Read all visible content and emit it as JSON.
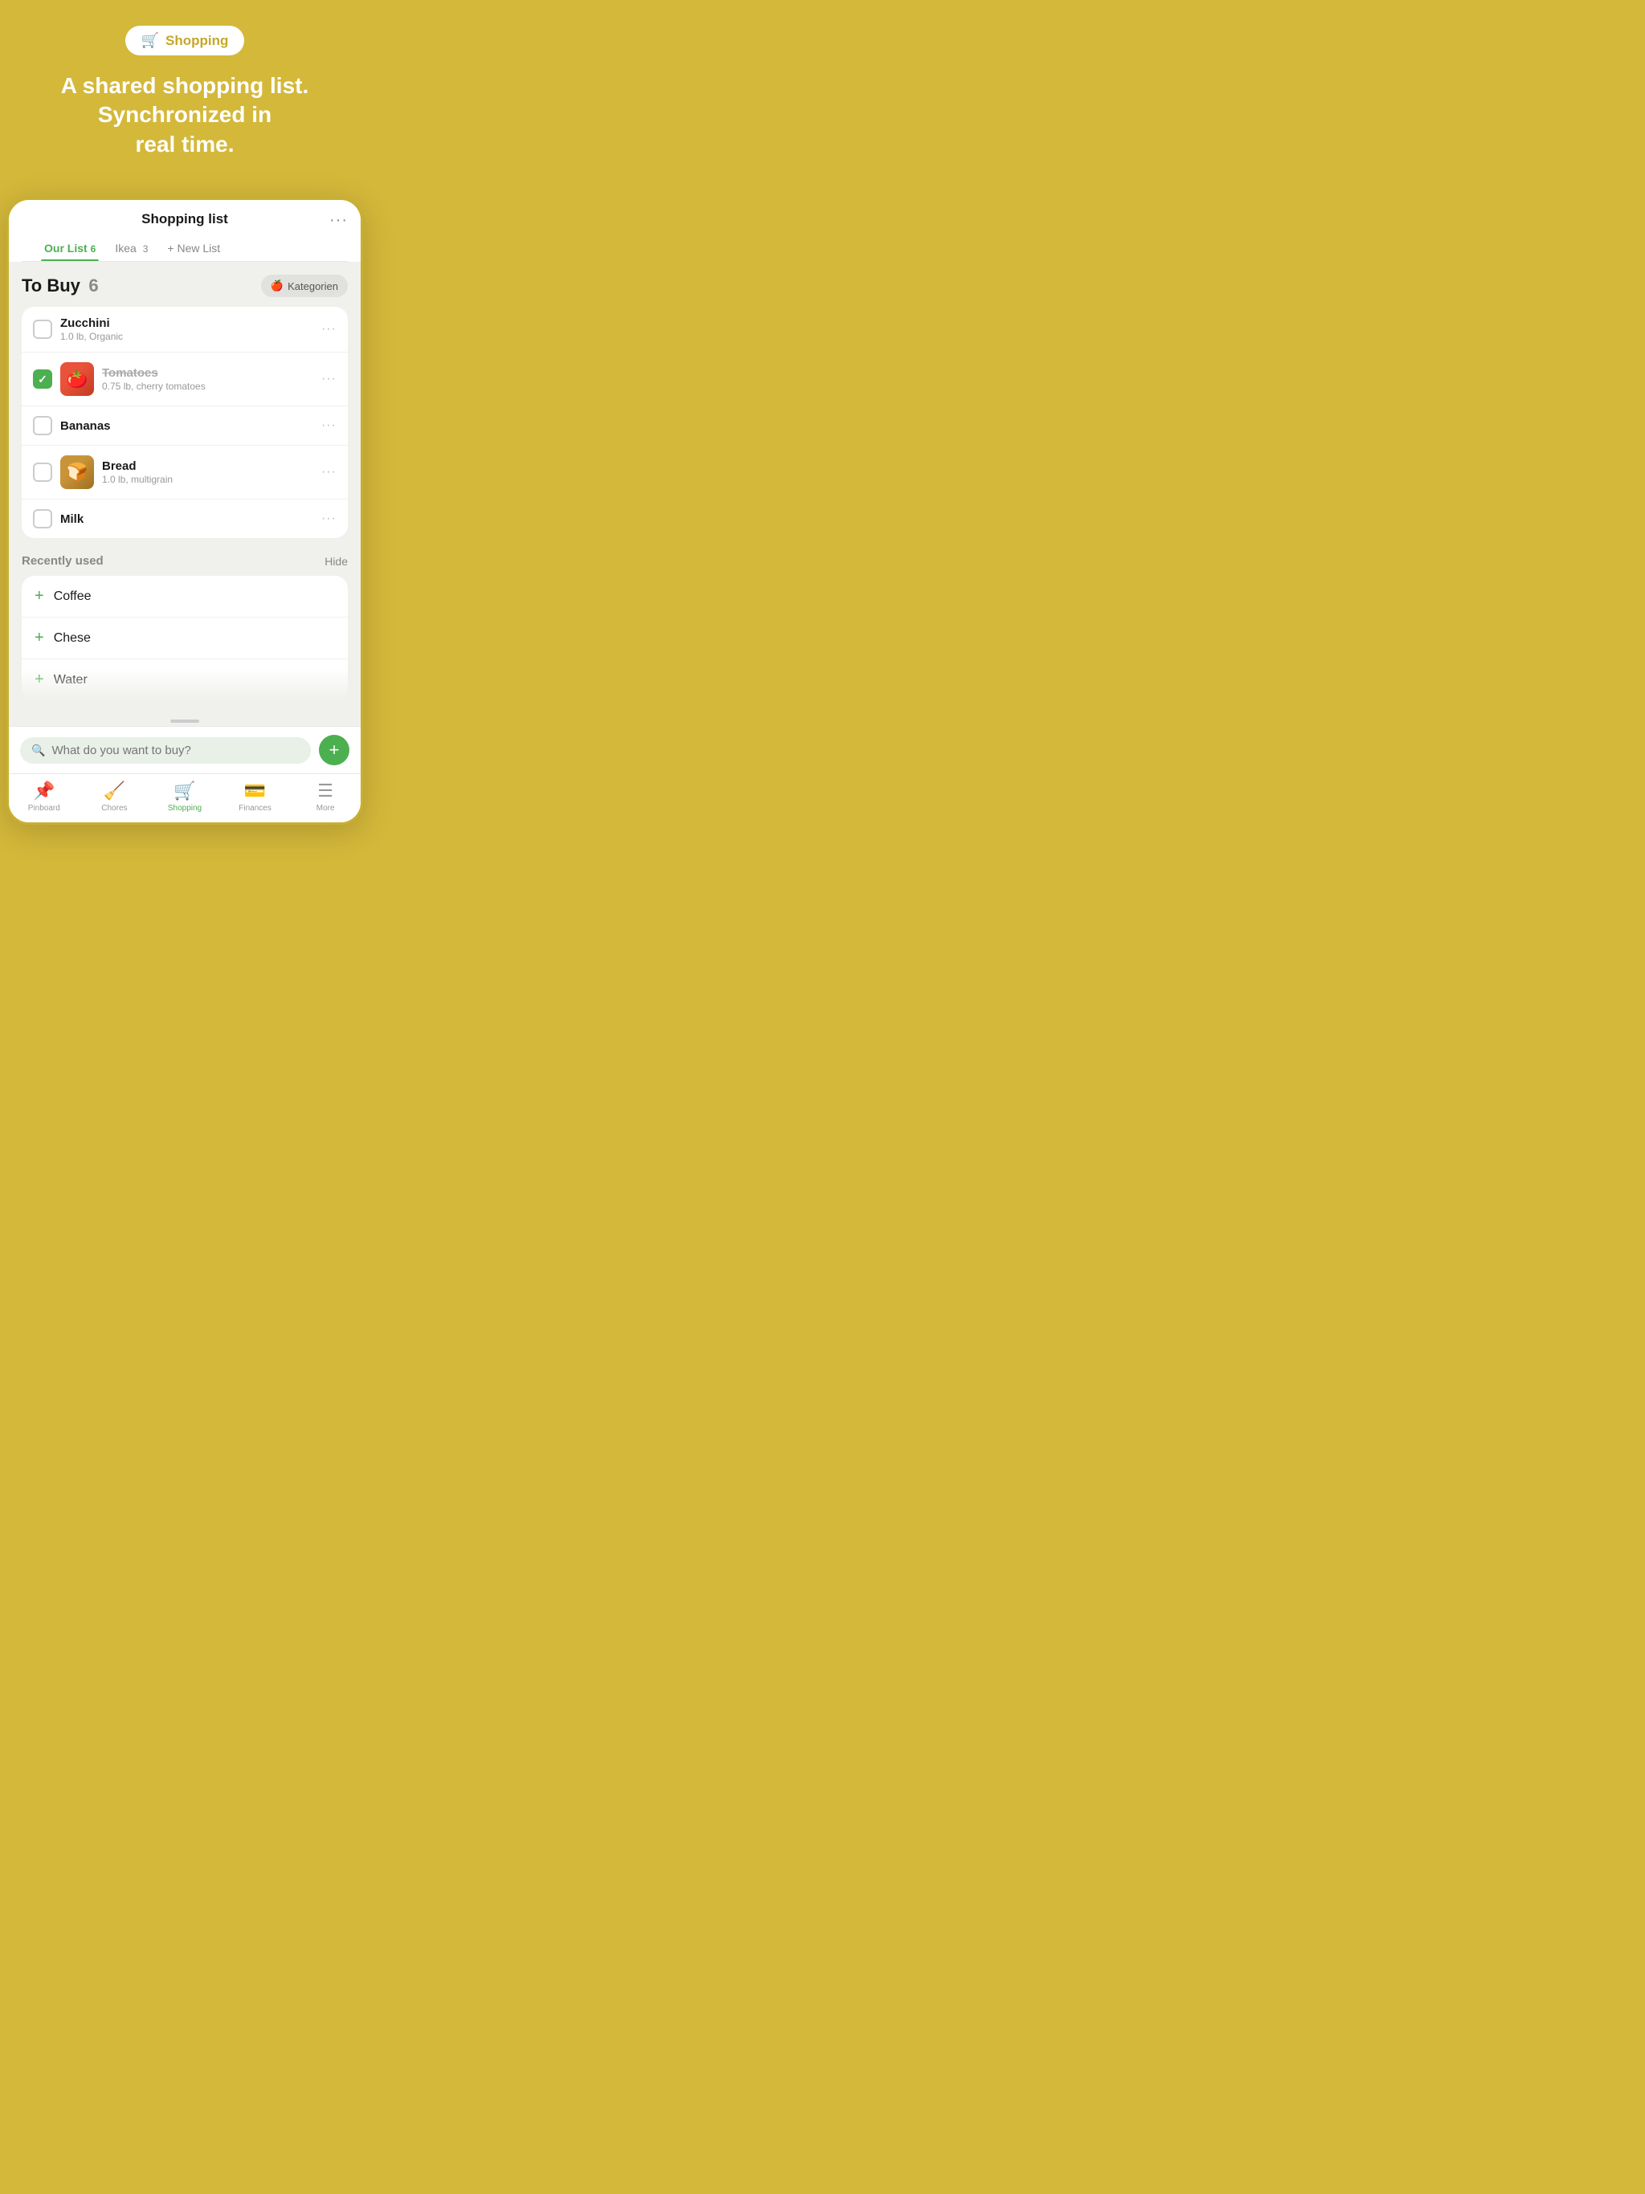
{
  "app": {
    "badge_icon": "🛒",
    "badge_label": "Shopping",
    "hero_title": "A shared shopping list.\nSynchronized in\nreal time.",
    "title": "Shopping list",
    "more_dots": "···"
  },
  "tabs": [
    {
      "id": "our-list",
      "label": "Our List",
      "count": "6",
      "active": true
    },
    {
      "id": "ikea",
      "label": "Ikea",
      "count": "3",
      "active": false
    },
    {
      "id": "new-list",
      "label": "+ New List",
      "count": "",
      "active": false
    }
  ],
  "to_buy": {
    "title": "To Buy",
    "count": "6",
    "kategorien_label": "Kategorien",
    "items": [
      {
        "id": "zucchini",
        "name": "Zucchini",
        "sub": "1.0 lb, Organic",
        "checked": false,
        "has_image": false
      },
      {
        "id": "tomatoes",
        "name": "Tomatoes",
        "sub": "0.75 lb, cherry tomatoes",
        "checked": true,
        "has_image": true,
        "image_type": "tomato"
      },
      {
        "id": "bananas",
        "name": "Bananas",
        "sub": "",
        "checked": false,
        "has_image": false
      },
      {
        "id": "bread",
        "name": "Bread",
        "sub": "1.0 lb, multigrain",
        "checked": false,
        "has_image": true,
        "image_type": "bread"
      },
      {
        "id": "milk",
        "name": "Milk",
        "sub": "",
        "checked": false,
        "has_image": false
      }
    ]
  },
  "recently_used": {
    "title": "Recently used",
    "hide_label": "Hide",
    "items": [
      {
        "id": "coffee",
        "name": "Coffee"
      },
      {
        "id": "cheese",
        "name": "Chese"
      },
      {
        "id": "water",
        "name": "Water"
      }
    ]
  },
  "search": {
    "placeholder": "What do you want to buy?",
    "add_label": "+"
  },
  "nav": {
    "items": [
      {
        "id": "pinboard",
        "icon": "pinboard",
        "label": "Pinboard",
        "active": false
      },
      {
        "id": "chores",
        "icon": "chores",
        "label": "Chores",
        "active": false
      },
      {
        "id": "shopping",
        "icon": "shopping",
        "label": "Shopping",
        "active": true
      },
      {
        "id": "finances",
        "icon": "finances",
        "label": "Finances",
        "active": false
      },
      {
        "id": "more",
        "icon": "more",
        "label": "More",
        "active": false
      }
    ]
  }
}
